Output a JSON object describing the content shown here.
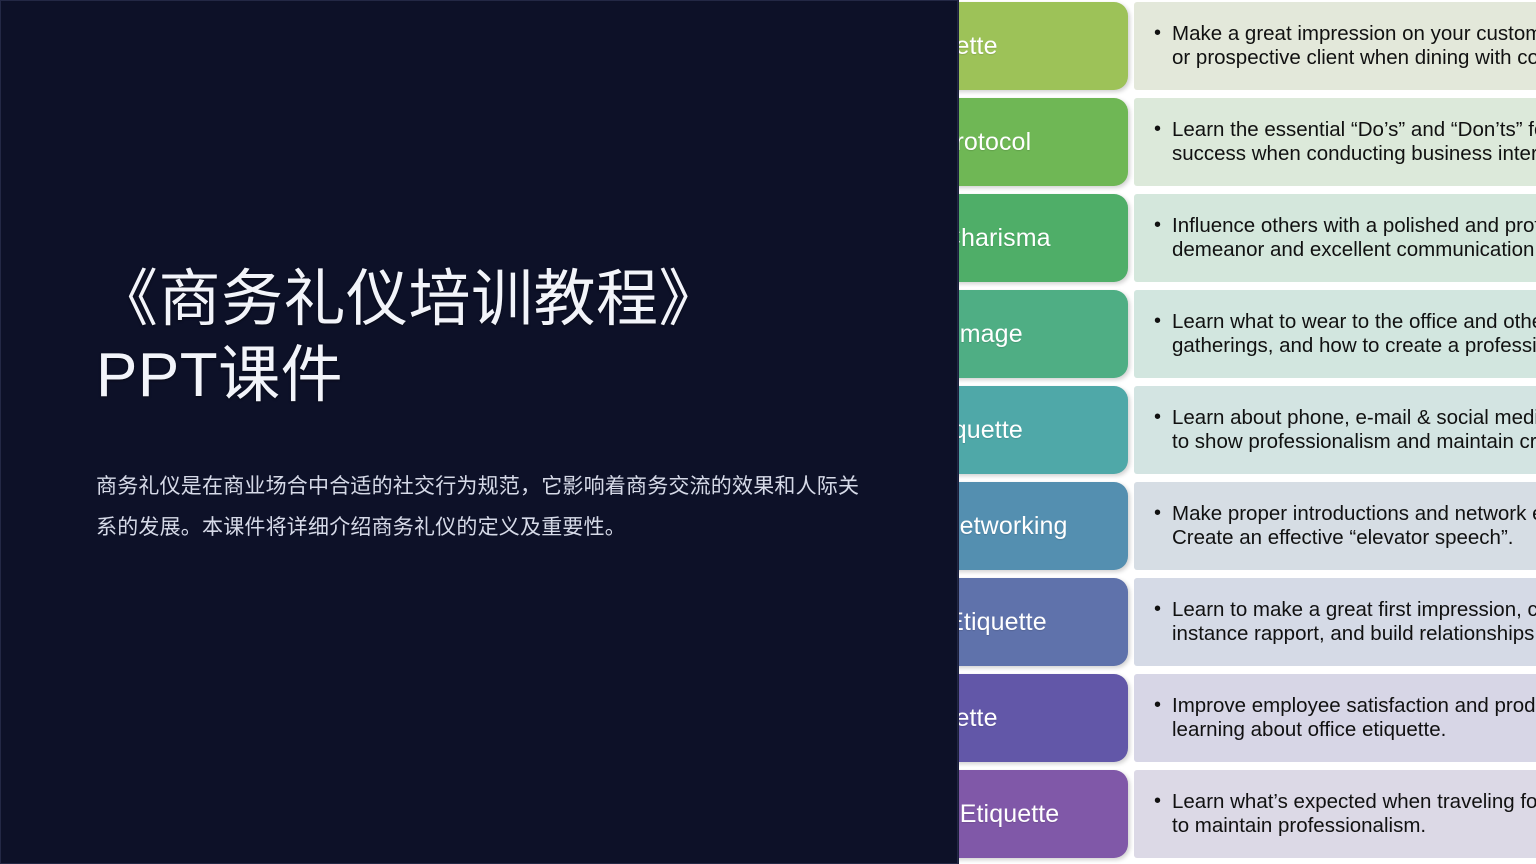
{
  "slide": {
    "background_color": "#0d1128",
    "title": "《商务礼仪培训教程》PPT课件",
    "title_line1": "《商务礼仪培训教程》",
    "title_line2": "PPT课件",
    "subtitle": "商务礼仪是在商业场合中合适的社交行为规范，它影响着商务交流的效果和人际关系的发展。本课件将详细介绍商务礼仪的定义及重要性。"
  },
  "topics": {
    "rows": [
      {
        "label": "Dining Etiquette",
        "visible_label": "Etiquette",
        "pill_color": "#9dc258",
        "desc_color": "#e3e8da",
        "desc_line1": "Make a great impression on your customer",
        "desc_line2": "or prospective client when dining with colleagues."
      },
      {
        "label": "International Protocol",
        "visible_label": "nal Protocol",
        "pill_color": "#6fb755",
        "desc_color": "#dce9da",
        "desc_line1": "Learn the essential “Do’s” and “Don’ts” for",
        "desc_line2": "success when conducting business internationally."
      },
      {
        "label": "Presence & Charisma",
        "visible_label": "e & Charisma",
        "pill_color": "#4fae68",
        "desc_color": "#d4e7dc",
        "desc_line1": "Influence others with a polished and professional",
        "desc_line2": "demeanor and excellent communication skills."
      },
      {
        "label": "Professional Image",
        "visible_label": "onal Image",
        "pill_color": "#4fae84",
        "desc_color": "#d2e6df",
        "desc_line1": "Learn what to wear to the office and other business",
        "desc_line2": "gatherings, and how to create a professional image."
      },
      {
        "label": "Electronic Etiquette",
        "visible_label": "ic Etiquette",
        "pill_color": "#4fa8a8",
        "desc_color": "#d3e4e2",
        "desc_line1": "Learn about phone, e-mail & social media etiquette",
        "desc_line2": "to show professionalism and maintain credibility."
      },
      {
        "label": "Introductions & Networking",
        "visible_label": "s & Networking",
        "pill_color": "#548fb0",
        "desc_color": "#d6dde4",
        "desc_line1": "Make proper introductions and network effectively.",
        "desc_line2": "Create an effective “elevator speech”."
      },
      {
        "label": "Cocktail Party Etiquette",
        "visible_label": "arty Etiquette",
        "pill_color": "#5f72ab",
        "desc_color": "#d5dae6",
        "desc_line1": "Learn to make a great first impression, create",
        "desc_line2": "instance rapport, and build relationships."
      },
      {
        "label": "Office Etiquette",
        "visible_label": "Etiquette",
        "pill_color": "#6257a8",
        "desc_color": "#d7d6e6",
        "desc_line1": "Improve employee satisfaction and productivity by",
        "desc_line2": "learning about office etiquette."
      },
      {
        "label": "Business Travel Etiquette",
        "visible_label": "ravel Etiquette",
        "pill_color": "#8058a8",
        "desc_color": "#dcd9e6",
        "desc_line1": "Learn what’s expected when traveling for business",
        "desc_line2": "to maintain professionalism."
      }
    ]
  }
}
